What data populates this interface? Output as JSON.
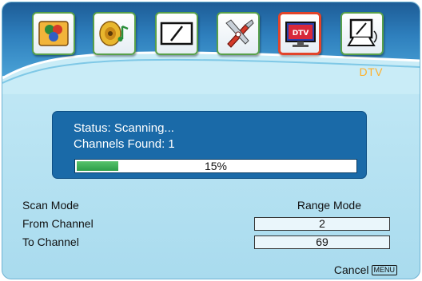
{
  "menu": {
    "icons": [
      {
        "name": "picture-icon",
        "selected": false
      },
      {
        "name": "sound-icon",
        "selected": false
      },
      {
        "name": "display-icon",
        "selected": false
      },
      {
        "name": "tools-icon",
        "selected": false
      },
      {
        "name": "dtv-icon",
        "selected": true
      },
      {
        "name": "pc-icon",
        "selected": false
      }
    ],
    "dtv_icon_text": "DTV",
    "section_label": "DTV"
  },
  "status": {
    "status_text": "Status: Scanning...",
    "channels_found_text": "Channels Found: 1",
    "progress_percent": 15,
    "progress_label": "15%"
  },
  "settings": {
    "scan_mode_label": "Scan Mode",
    "scan_mode_value": "Range Mode",
    "from_channel_label": "From Channel",
    "from_channel_value": "2",
    "to_channel_label": "To Channel",
    "to_channel_value": "69"
  },
  "footer": {
    "cancel_label": "Cancel",
    "cancel_key": "MENU"
  },
  "colors": {
    "header_blue": "#2e7fbd",
    "status_box": "#1a6aa8",
    "progress_green": "#2d9e48",
    "selected_border": "#e2442a",
    "section_label": "#ffb02a"
  }
}
